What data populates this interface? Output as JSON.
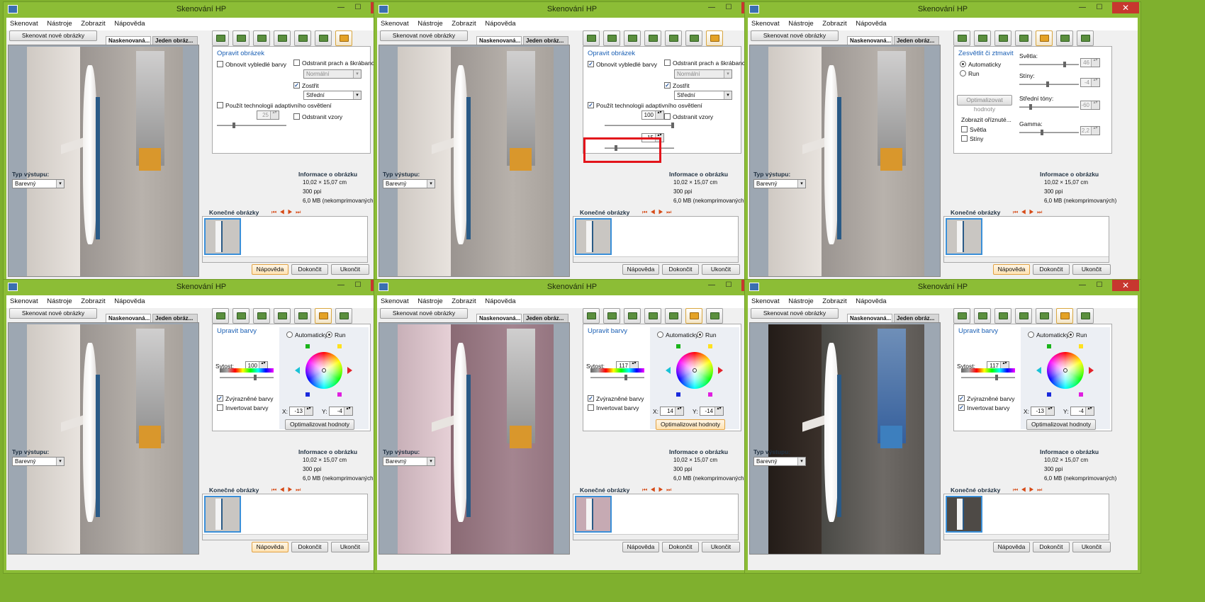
{
  "window": {
    "title": "Skenování HP",
    "min": "—",
    "max": "☐",
    "close": "✕"
  },
  "menu": [
    "Skenovat",
    "Nástroje",
    "Zobrazit",
    "Nápověda"
  ],
  "left": {
    "scan_new": "Skenovat nové obrázky",
    "tab_scanned": "Naskenovaná...",
    "tab_single": "Jeden obráz..."
  },
  "output": {
    "type_label": "Typ výstupu:",
    "type_value": "Barevný"
  },
  "info": {
    "header": "Informace o obrázku",
    "size": "10,02 × 15,07 cm",
    "dpi": "300 ppi",
    "mb": "6,0 MB (nekomprimovaných)"
  },
  "final_label": "Konečné obrázky",
  "nav_icons": "⏮ ◀ ▶ ⏭",
  "buttons": {
    "help": "Nápověda",
    "done": "Dokončit",
    "exit": "Ukončit"
  },
  "fix": {
    "title": "Opravit obrázek",
    "restore": "Obnovit vybledlé barvy",
    "dust": "Odstranit prach a škrábance",
    "dust_value": "Normální",
    "sharpen": "Zostřit",
    "sharpen_value": "Střední",
    "adaptive": "Použít technologii adaptivního osvětlení",
    "adaptive_value": "25",
    "restore_value": "100",
    "adaptive_value_b": "15",
    "patterns": "Odstranit vzory"
  },
  "light": {
    "title": "Zesvětlit či ztmavit",
    "auto": "Automaticky",
    "manual": "Run",
    "optimize": "Optimalizovat hodnoty",
    "show_clipped": "Zobrazit oříznuté...",
    "hl_check": "Světla",
    "sh_check": "Stíny",
    "highlights": "Světla:",
    "highlights_value": "46",
    "shadows": "Stíny:",
    "shadows_value": "-4",
    "midtones": "Střední tóny:",
    "midtones_value": "-60",
    "gamma": "Gamma:",
    "gamma_value": "2,2"
  },
  "color": {
    "title": "Upravit barvy",
    "auto": "Automaticky",
    "manual": "Run",
    "saturation": "Sytost:",
    "vivid": "Zvýrazněné barvy",
    "invert": "Invertovat barvy",
    "x": "X:",
    "y": "Y:",
    "optimize": "Optimalizovat hodnoty"
  },
  "panels": [
    {
      "mode": "fix",
      "restore": false,
      "sharpen": true,
      "adaptive": false
    },
    {
      "mode": "fix",
      "restore": true,
      "sharpen": true,
      "adaptive": true
    },
    {
      "mode": "light"
    },
    {
      "mode": "color",
      "sat": "100",
      "x": "-13",
      "y": "-4",
      "invert": false
    },
    {
      "mode": "color",
      "sat": "117",
      "x": "14",
      "y": "-14",
      "invert": false
    },
    {
      "mode": "color",
      "sat": "117",
      "x": "-13",
      "y": "-4",
      "invert": true
    }
  ],
  "colors": {
    "desktop": "#7fb02e",
    "close": "#c7372f",
    "highlight": "#e3141b",
    "accent": "#1a5fb4"
  }
}
